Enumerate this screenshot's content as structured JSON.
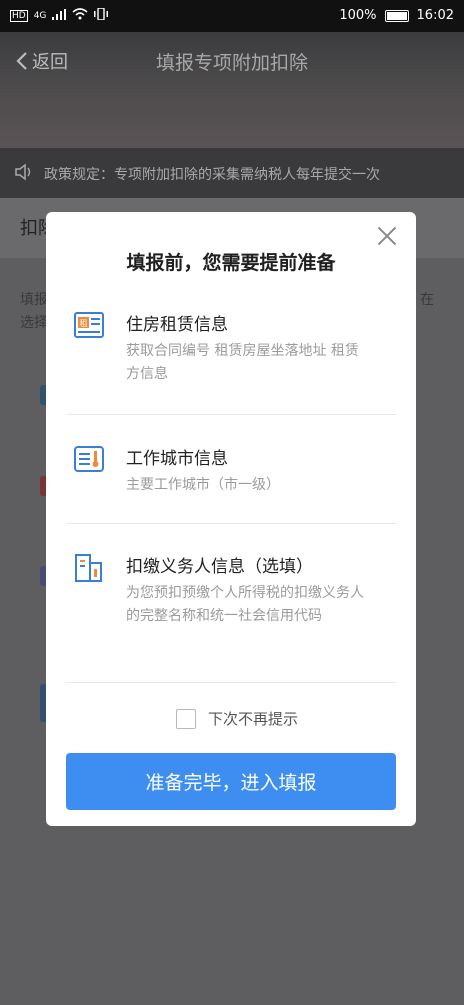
{
  "status_bar": {
    "battery_percent": "100%",
    "time": "16:02",
    "network": "4G"
  },
  "header": {
    "back_label": "返回",
    "title": "填报专项附加扣除"
  },
  "notice": {
    "text": "政策规定：专项附加扣除的采集需纳税人每年提交一次"
  },
  "background": {
    "section_title_partial": "扣除",
    "text_line1_partial": "填报",
    "text_line2_partial": "选择",
    "text_right_partial": "在"
  },
  "modal": {
    "title": "填报前，您需要提前准备",
    "items": [
      {
        "icon": "rental-contract-icon",
        "icon_text": "租",
        "name": "住房租赁信息",
        "desc": "获取合同编号 租赁房屋坐落地址 租赁方信息"
      },
      {
        "icon": "city-info-icon",
        "name": "工作城市信息",
        "desc": "主要工作城市（市一级）"
      },
      {
        "icon": "building-icon",
        "name": "扣缴义务人信息（选填）",
        "desc": "为您预扣预缴个人所得税的扣缴义务人的完整名称和统一社会信用代码"
      }
    ],
    "dont_show_again": "下次不再提示",
    "dont_show_again_checked": false,
    "confirm_button": "准备完毕，进入填报"
  },
  "colors": {
    "primary": "#3d8ef0",
    "icon_blue": "#3a7fd6",
    "icon_orange": "#f08a3a",
    "overlay": "#5e5e60"
  }
}
